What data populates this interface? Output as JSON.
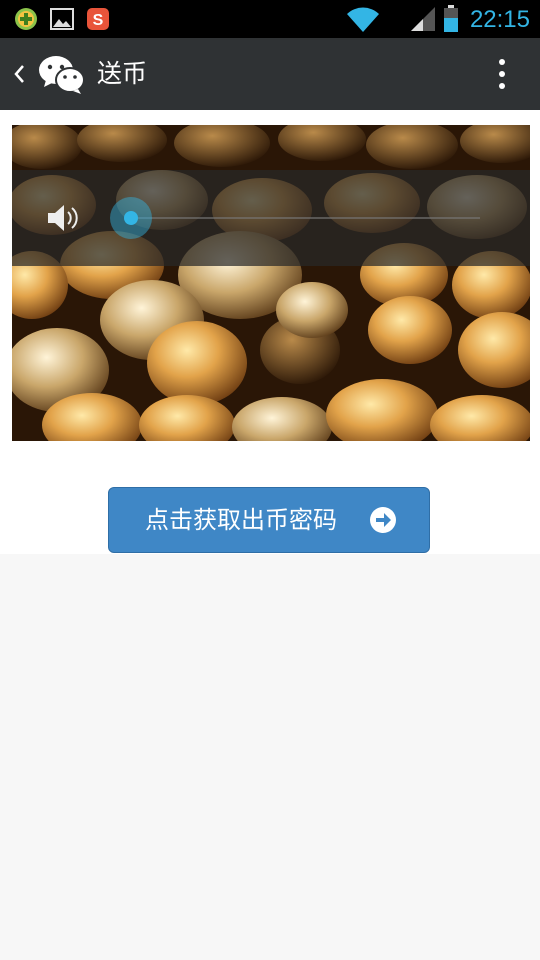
{
  "status_bar": {
    "time": "22:15",
    "icons": [
      "app-plus-icon",
      "gallery-icon",
      "sogou-input-icon",
      "wifi-icon",
      "signal-icon",
      "battery-icon"
    ],
    "accent_color": "#33b5e5"
  },
  "action_bar": {
    "title": "送币",
    "icons": [
      "back-chevron-icon",
      "wechat-logo-icon",
      "overflow-menu-icon"
    ],
    "background": "#2f3234"
  },
  "volume_overlay": {
    "level": 0.0,
    "icon": "speaker-icon"
  },
  "cta": {
    "label": "点击获取出币密码",
    "icon": "arrow-right-circle-icon",
    "color": "#3f87c6"
  }
}
